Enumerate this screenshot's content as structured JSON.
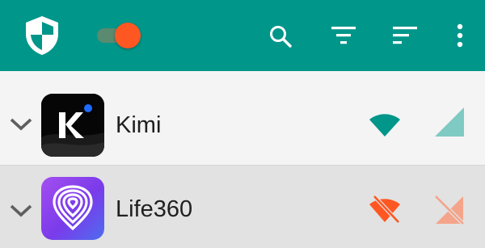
{
  "toolbar": {
    "background": "#00968a",
    "icons": [
      "shield-icon",
      "toggle-switch",
      "search-icon",
      "filter-icon",
      "sort-icon",
      "more-vert-icon"
    ],
    "toggle_on": true,
    "toggle_thumb_color": "#ff5722"
  },
  "apps": [
    {
      "name": "Kimi",
      "icon": "kimi-app-icon",
      "wifi": "allowed",
      "mobile": "allowed",
      "wifi_color": "#00968a",
      "mobile_color": "#7fcac2"
    },
    {
      "name": "Life360",
      "icon": "life360-app-icon",
      "wifi": "blocked",
      "mobile": "blocked",
      "wifi_color": "#ff5722",
      "mobile_color": "#f4a48a"
    }
  ]
}
